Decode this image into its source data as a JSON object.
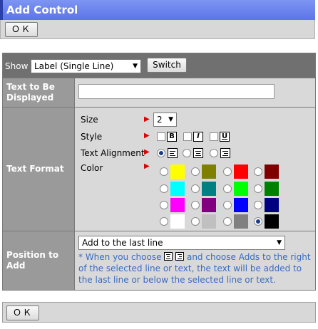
{
  "window": {
    "title": "Add Control"
  },
  "top_toolbar": {
    "ok_label": "ＯＫ"
  },
  "show_row": {
    "label": "Show",
    "selected_control": "Label (Single Line)",
    "switch_label": "Switch"
  },
  "text_row": {
    "label": "Text to Be Displayed",
    "value": ""
  },
  "text_format": {
    "label": "Text Format",
    "size_label": "Size",
    "size_value": "2",
    "style_label": "Style",
    "style_options": [
      "B",
      "I",
      "U"
    ],
    "alignment_label": "Text Alignment",
    "alignment_selected": "left",
    "color_label": "Color",
    "colors": [
      "#ffff00",
      "#808000",
      "#ff0000",
      "#800000",
      "#00ffff",
      "#008080",
      "#00ff00",
      "#008000",
      "#ff00ff",
      "#800080",
      "#0000ff",
      "#000080",
      "#ffffff",
      "#c0c0c0",
      "#808080",
      "#000000"
    ],
    "selected_color": "#000000"
  },
  "position_row": {
    "label": "Position to Add",
    "selected_option": "Add to the last line",
    "note_part1": "* When you choose",
    "note_part2": "and choose Adds to the right of the selected line or text, the text will be added to the last line or below the selected line or text."
  },
  "bottom_toolbar": {
    "ok_label": "ＯＫ"
  },
  "theme": {
    "accent": "#6a80ee",
    "note_color": "#3a6bc2",
    "header_gray": "#707070",
    "label_gray": "#9a9a9a",
    "cell_gray": "#d9d9d9"
  }
}
